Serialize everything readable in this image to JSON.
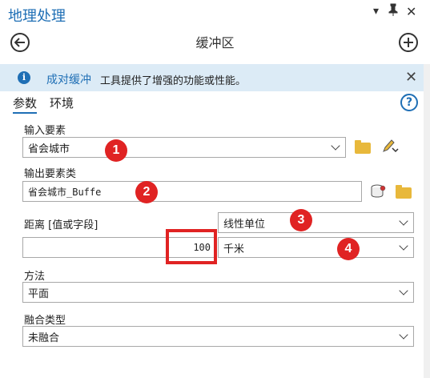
{
  "panel": {
    "title": "地理处理",
    "controls": {
      "menu": "▾",
      "pin": "📌",
      "close": "✕"
    }
  },
  "header": {
    "title": "缓冲区",
    "back_icon": "arrow-left-circle",
    "add_icon": "plus-circle"
  },
  "info_bar": {
    "icon": "i",
    "link_text": "成对缓冲",
    "message": "工具提供了增强的功能或性能。",
    "close": "✕"
  },
  "tabs": [
    {
      "label": "参数",
      "active": true
    },
    {
      "label": "环境",
      "active": false
    }
  ],
  "help": "?",
  "form": {
    "input_features": {
      "label": "输入要素",
      "value": "省会城市"
    },
    "output_features": {
      "label": "输出要素类",
      "value": "省会城市_Buffe"
    },
    "distance": {
      "label": "距离 [值或字段]",
      "value": "100",
      "unit_mode": "线性单位",
      "unit": "千米"
    },
    "method": {
      "label": "方法",
      "value": "平面"
    },
    "dissolve": {
      "label": "融合类型",
      "value": "未融合"
    }
  },
  "annotations": [
    "1",
    "2",
    "3",
    "4"
  ],
  "colors": {
    "accent": "#1f6fb5",
    "info_bg": "#dcebf6",
    "annotation": "#e02323"
  }
}
